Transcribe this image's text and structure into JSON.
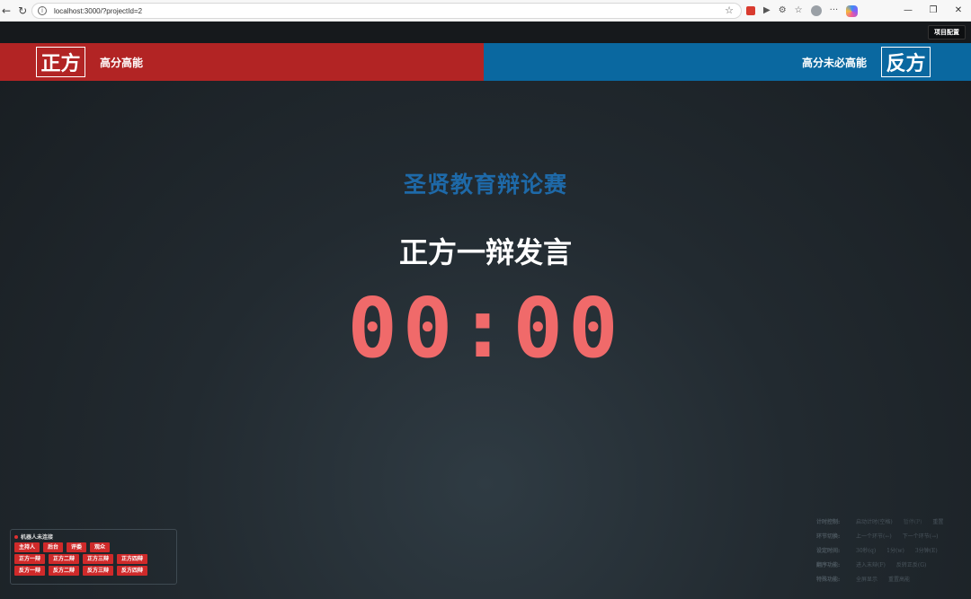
{
  "browser": {
    "url": "localhost:3000/?projectId=2"
  },
  "app": {
    "config_button": "项目配置",
    "pro": {
      "side": "正方",
      "topic": "高分高能"
    },
    "con": {
      "side": "反方",
      "topic": "高分未必高能"
    },
    "title": "圣贤教育辩论赛",
    "stage": "正方一辩发言",
    "timer": "00:00",
    "colors": {
      "pro": "#b22424",
      "con": "#0a68a0",
      "timer": "#f06a6a",
      "title": "#1e69a8"
    }
  },
  "robot": {
    "status": "机器人未连接",
    "rows": [
      [
        "主持人",
        "后台",
        "评委",
        "观众"
      ],
      [
        "正方一辩",
        "正方二辩",
        "正方三辩",
        "正方四辩"
      ],
      [
        "反方一辩",
        "反方二辩",
        "反方三辩",
        "反方四辩"
      ]
    ]
  },
  "controls": {
    "rows": [
      {
        "label": "计时控制:",
        "items": [
          "启动计时(空格)",
          "暂停(P)",
          "重置"
        ]
      },
      {
        "label": "环节切换:",
        "items": [
          "上一个环节(←)",
          "下一个环节(→)"
        ]
      },
      {
        "label": "设定时间:",
        "items": [
          "30秒(q)",
          "1分(w)",
          "3分钟(E)"
        ]
      },
      {
        "label": "翻序功能:",
        "items": [
          "进入末辩(F)",
          "反转正反(G)"
        ]
      },
      {
        "label": "特殊功能:",
        "items": [
          "全屏显示",
          "重置高能"
        ]
      }
    ]
  }
}
